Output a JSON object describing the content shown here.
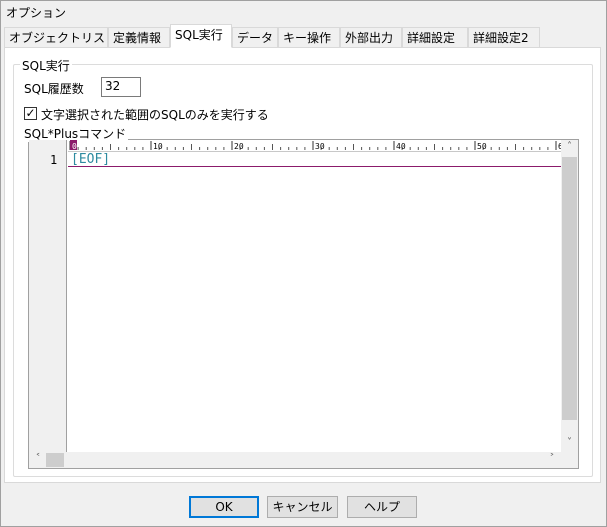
{
  "window": {
    "title": "オプション"
  },
  "tabs": [
    {
      "label": "オブジェクトリスト"
    },
    {
      "label": "定義情報"
    },
    {
      "label": "SQL実行",
      "active": true
    },
    {
      "label": "データ"
    },
    {
      "label": "キー操作"
    },
    {
      "label": "外部出力"
    },
    {
      "label": "詳細設定"
    },
    {
      "label": "詳細設定2"
    }
  ],
  "sql_group": {
    "title": "SQL実行",
    "history_label": "SQL履歴数",
    "history_value": "32",
    "checkbox_label": "文字選択された範囲のSQLのみを実行する",
    "checkbox_checked": true,
    "checkbox_mark": "✓"
  },
  "editor": {
    "label": "SQL*Plusコマンド",
    "line_number": "1",
    "content": "[EOF]",
    "ruler_marks": [
      "0",
      "10",
      "20",
      "30",
      "40",
      "50",
      "60"
    ]
  },
  "buttons": {
    "ok": "OK",
    "cancel": "キャンセル",
    "help": "ヘルプ"
  },
  "colors": {
    "eof_text": "#2e8ba0",
    "caret_line": "#8b1a6b",
    "ok_border": "#0078d7"
  }
}
